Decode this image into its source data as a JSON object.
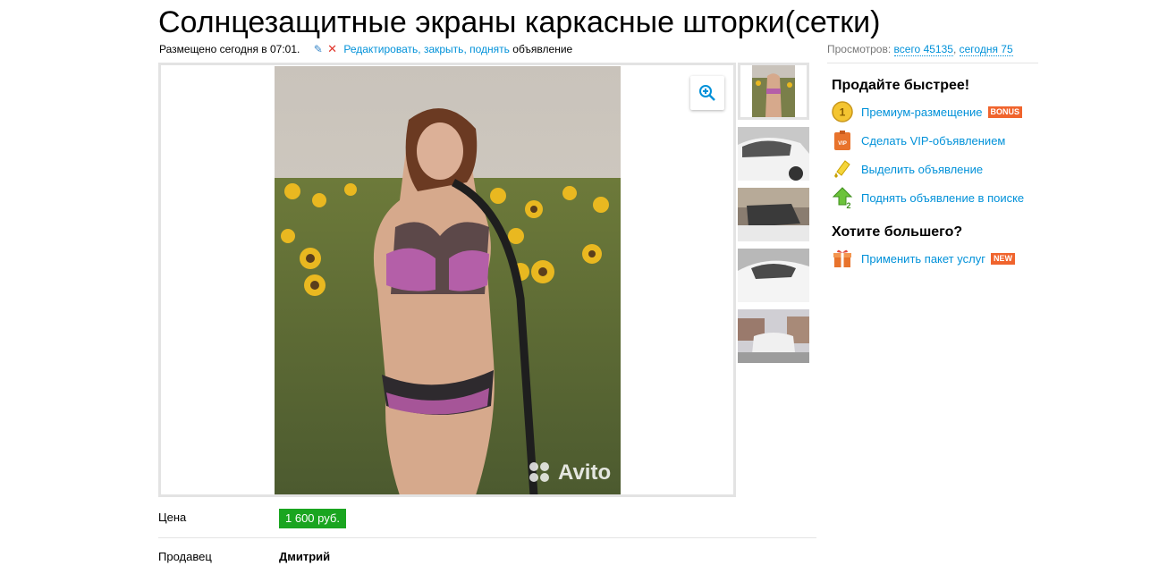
{
  "title": "Солнцезащитные экраны каркасные шторки(сетки)",
  "meta": {
    "posted": "Размещено сегодня в 07:01.",
    "edit_link": "Редактировать",
    "close_link": "закрыть",
    "raise_link": "поднять",
    "suffix": "объявление",
    "comma": ","
  },
  "views": {
    "label": "Просмотров:",
    "total": "всего 45135",
    "today": "сегодня 75"
  },
  "photo": {
    "watermark": "Avito",
    "thumb_count": 5
  },
  "sidebar": {
    "sell_faster_heading": "Продайте быстрее!",
    "items": [
      {
        "label": "Премиум-размещение",
        "badge": "BONUS",
        "icon": "premium-coin-icon"
      },
      {
        "label": "Сделать VIP-объявлением",
        "icon": "vip-badge-icon"
      },
      {
        "label": "Выделить объявление",
        "icon": "highlighter-icon"
      },
      {
        "label": "Поднять объявление в поиске",
        "icon": "up-arrow-icon"
      }
    ],
    "want_more_heading": "Хотите большего?",
    "package": {
      "label": "Применить пакет услуг",
      "badge": "NEW",
      "icon": "gift-box-icon"
    }
  },
  "price": {
    "label": "Цена",
    "value": "1 600 руб."
  },
  "seller": {
    "label": "Продавец",
    "name": "Дмитрий"
  },
  "colors": {
    "link": "#0091d9",
    "price_bg": "#1aa520",
    "badge": "#f0642d"
  }
}
